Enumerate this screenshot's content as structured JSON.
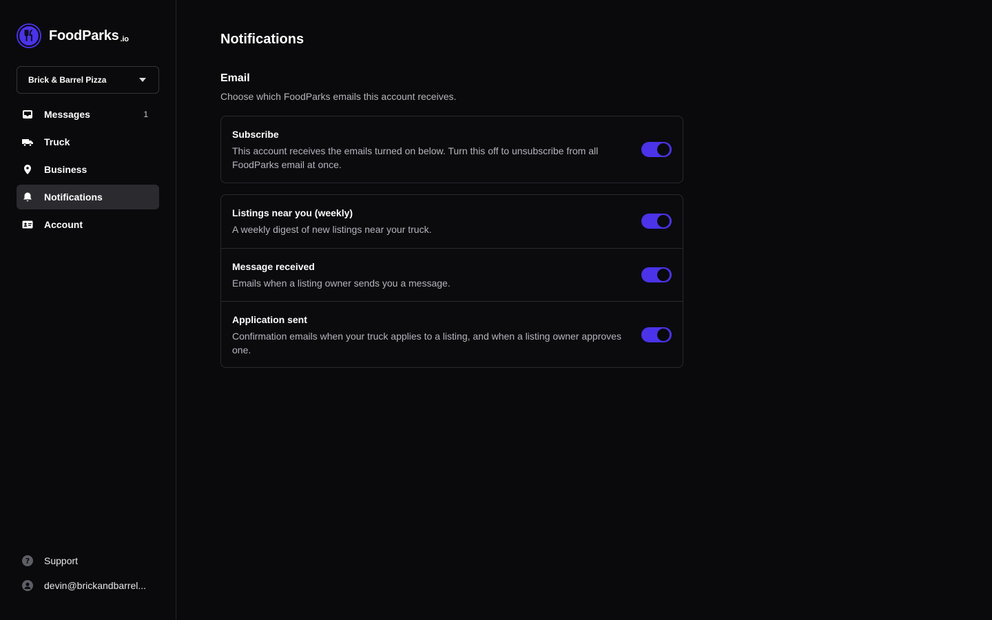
{
  "brand": {
    "name": "FoodParks",
    "suffix": ".io",
    "accent": "#4a33e8"
  },
  "org_selector": {
    "value": "Brick & Barrel Pizza"
  },
  "sidebar": {
    "items": [
      {
        "label": "Messages",
        "icon": "inbox-icon",
        "count": "1",
        "active": false
      },
      {
        "label": "Truck",
        "icon": "truck-icon",
        "active": false
      },
      {
        "label": "Business",
        "icon": "map-pin-icon",
        "active": false
      },
      {
        "label": "Notifications",
        "icon": "bell-icon",
        "active": true
      },
      {
        "label": "Account",
        "icon": "id-card-icon",
        "active": false
      }
    ],
    "bottom": [
      {
        "label": "Support",
        "icon": "help-circle-icon"
      },
      {
        "label": "devin@brickandbarrel...",
        "icon": "user-avatar-icon"
      }
    ]
  },
  "main": {
    "title": "Notifications",
    "section": {
      "title": "Email",
      "subtitle": "Choose which FoodParks emails this account receives."
    },
    "subscribe": {
      "title": "Subscribe",
      "description": "This account receives the emails turned on below. Turn this off to unsubscribe from all FoodParks email at once.",
      "enabled": true
    },
    "options": [
      {
        "title": "Listings near you (weekly)",
        "description": "A weekly digest of new listings near your truck.",
        "enabled": true
      },
      {
        "title": "Message received",
        "description": "Emails when a listing owner sends you a message.",
        "enabled": true
      },
      {
        "title": "Application sent",
        "description": "Confirmation emails when your truck applies to a listing, and when a listing owner approves one.",
        "enabled": true
      }
    ]
  }
}
